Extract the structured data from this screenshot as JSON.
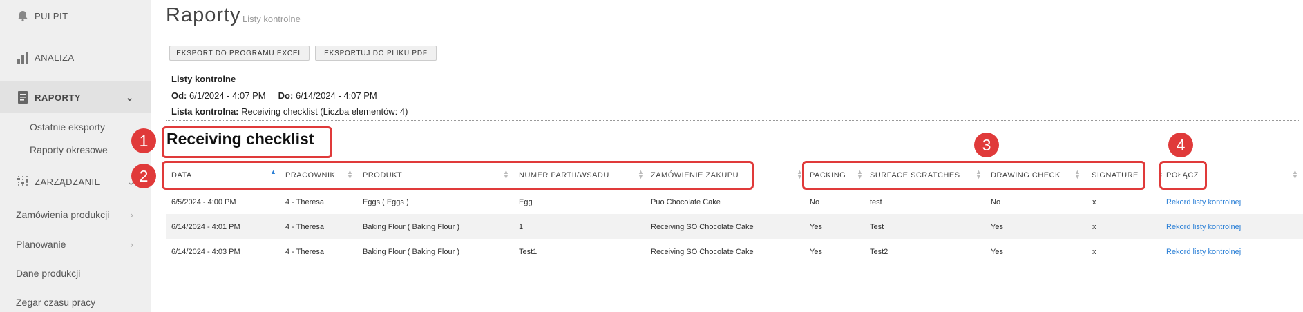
{
  "sidebar": {
    "pulpit": "PULPIT",
    "analiza": "ANALIZA",
    "raporty": "RAPORTY",
    "ostatnie": "Ostatnie eksporty",
    "okresowe": "Raporty okresowe",
    "zarzadzanie": "ZARZĄDZANIE",
    "zamowienia": "Zamówienia produkcji",
    "planowanie": "Planowanie",
    "dane": "Dane produkcji",
    "zegar": "Zegar czasu pracy"
  },
  "header": {
    "title": "Raporty",
    "subtitle": "Listy kontrolne"
  },
  "toolbar": {
    "excel": "EKSPORT DO PROGRAMU EXCEL",
    "pdf": "EKSPORTUJ DO PLIKU PDF"
  },
  "info": {
    "heading": "Listy kontrolne",
    "od_label": "Od:",
    "od_value": "6/1/2024 - 4:07 PM",
    "do_label": "Do:",
    "do_value": "6/14/2024 - 4:07 PM",
    "lista_label": "Lista kontrolna:",
    "lista_value": "Receiving checklist (Liczba elementów: 4)"
  },
  "section_title": "Receiving checklist",
  "table": {
    "headers": {
      "data": "DATA",
      "pracownik": "PRACOWNIK",
      "produkt": "PRODUKT",
      "numer": "NUMER PARTII/WSADU",
      "zamowienie": "ZAMÓWIENIE ZAKUPU",
      "packing": "PACKING",
      "surface": "SURFACE SCRATCHES",
      "drawing": "DRAWING CHECK",
      "signature": "SIGNATURE",
      "polacz": "POŁĄCZ"
    },
    "rows": [
      {
        "data": "6/5/2024 - 4:00 PM",
        "pracownik": "4 - Theresa",
        "produkt": "Eggs ( Eggs )",
        "numer": "Egg",
        "zamowienie": "Puo Chocolate Cake",
        "packing": "No",
        "surface": "test",
        "drawing": "No",
        "signature": "x",
        "polacz": "Rekord listy kontrolnej"
      },
      {
        "data": "6/14/2024 - 4:01 PM",
        "pracownik": "4 - Theresa",
        "produkt": "Baking Flour ( Baking Flour )",
        "numer": "1",
        "zamowienie": "Receiving SO Chocolate Cake",
        "packing": "Yes",
        "surface": "Test",
        "drawing": "Yes",
        "signature": "x",
        "polacz": "Rekord listy kontrolnej"
      },
      {
        "data": "6/14/2024 - 4:03 PM",
        "pracownik": "4 - Theresa",
        "produkt": "Baking Flour ( Baking Flour )",
        "numer": "Test1",
        "zamowienie": "Receiving SO Chocolate Cake",
        "packing": "Yes",
        "surface": "Test2",
        "drawing": "Yes",
        "signature": "x",
        "polacz": "Rekord listy kontrolnej"
      }
    ]
  },
  "annotations": [
    "1",
    "2",
    "3",
    "4"
  ],
  "colors": {
    "accent": "#e03a3a",
    "link": "#2a7fd6",
    "sort_active": "#2a7fd6"
  }
}
